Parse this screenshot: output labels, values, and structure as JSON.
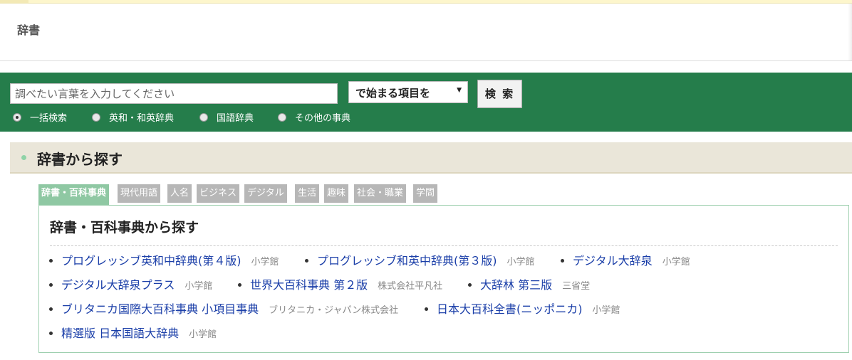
{
  "header": {
    "title": "辞書"
  },
  "search": {
    "placeholder": "調べたい言葉を入力してください",
    "mode_selected": "で始まる項目を",
    "button_label": "検 索",
    "scopes": [
      {
        "label": "一括検索",
        "checked": true
      },
      {
        "label": "英和・和英辞典",
        "checked": false
      },
      {
        "label": "国語辞典",
        "checked": false
      },
      {
        "label": "その他の事典",
        "checked": false
      }
    ]
  },
  "section": {
    "title": "辞書から探す"
  },
  "tabs": [
    {
      "label": "辞書・百科事典",
      "active": true
    },
    {
      "label": "現代用語",
      "active": false
    },
    {
      "label": "人名",
      "active": false
    },
    {
      "label": "ビジネス",
      "active": false
    },
    {
      "label": "デジタル",
      "active": false
    },
    {
      "label": "生活",
      "active": false
    },
    {
      "label": "趣味",
      "active": false
    },
    {
      "label": "社会・職業",
      "active": false
    },
    {
      "label": "学問",
      "active": false
    }
  ],
  "panel": {
    "title": "辞書・百科事典から探す",
    "entries": [
      {
        "name": "プログレッシブ英和中辞典(第４版)",
        "publisher": "小学館"
      },
      {
        "name": "プログレッシブ和英中辞典(第３版)",
        "publisher": "小学館"
      },
      {
        "name": "デジタル大辞泉",
        "publisher": "小学館"
      },
      {
        "name": "デジタル大辞泉プラス",
        "publisher": "小学館"
      },
      {
        "name": "世界大百科事典 第２版",
        "publisher": "株式会社平凡社"
      },
      {
        "name": "大辞林 第三版",
        "publisher": "三省堂"
      },
      {
        "name": "ブリタニカ国際大百科事典 小項目事典",
        "publisher": "ブリタニカ・ジャパン株式会社"
      },
      {
        "name": "日本大百科全書(ニッポニカ)",
        "publisher": "小学館"
      },
      {
        "name": "精選版 日本国語大辞典",
        "publisher": "小学館"
      }
    ]
  },
  "colors": {
    "search_bar": "#257d4b",
    "section_head": "#eae6d9",
    "tab_active": "#8fc8a3",
    "tab_inactive": "#b7b7b7",
    "link": "#1a3ea8"
  }
}
